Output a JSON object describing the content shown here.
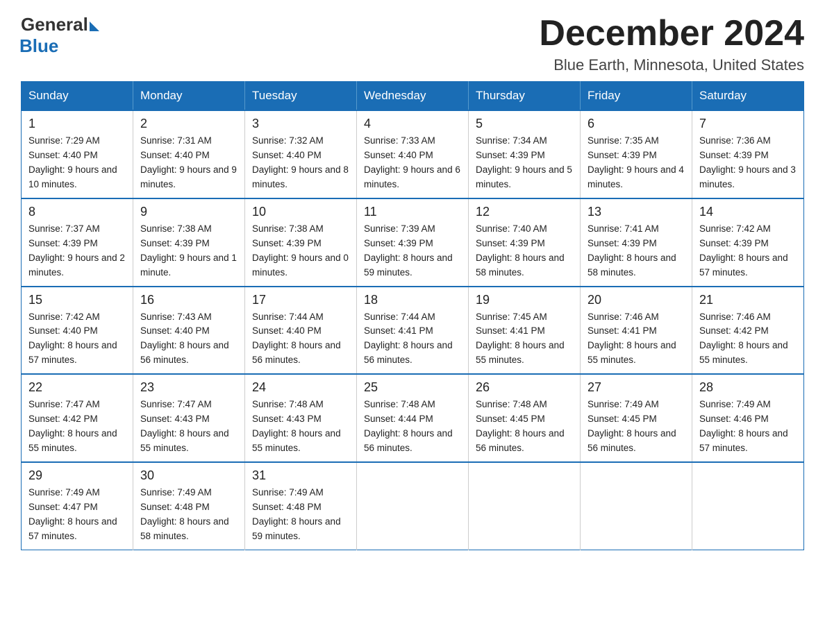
{
  "header": {
    "logo_general": "General",
    "logo_blue": "Blue",
    "month_title": "December 2024",
    "location": "Blue Earth, Minnesota, United States"
  },
  "days_of_week": [
    "Sunday",
    "Monday",
    "Tuesday",
    "Wednesday",
    "Thursday",
    "Friday",
    "Saturday"
  ],
  "weeks": [
    [
      {
        "day": "1",
        "sunrise": "7:29 AM",
        "sunset": "4:40 PM",
        "daylight": "9 hours and 10 minutes."
      },
      {
        "day": "2",
        "sunrise": "7:31 AM",
        "sunset": "4:40 PM",
        "daylight": "9 hours and 9 minutes."
      },
      {
        "day": "3",
        "sunrise": "7:32 AM",
        "sunset": "4:40 PM",
        "daylight": "9 hours and 8 minutes."
      },
      {
        "day": "4",
        "sunrise": "7:33 AM",
        "sunset": "4:40 PM",
        "daylight": "9 hours and 6 minutes."
      },
      {
        "day": "5",
        "sunrise": "7:34 AM",
        "sunset": "4:39 PM",
        "daylight": "9 hours and 5 minutes."
      },
      {
        "day": "6",
        "sunrise": "7:35 AM",
        "sunset": "4:39 PM",
        "daylight": "9 hours and 4 minutes."
      },
      {
        "day": "7",
        "sunrise": "7:36 AM",
        "sunset": "4:39 PM",
        "daylight": "9 hours and 3 minutes."
      }
    ],
    [
      {
        "day": "8",
        "sunrise": "7:37 AM",
        "sunset": "4:39 PM",
        "daylight": "9 hours and 2 minutes."
      },
      {
        "day": "9",
        "sunrise": "7:38 AM",
        "sunset": "4:39 PM",
        "daylight": "9 hours and 1 minute."
      },
      {
        "day": "10",
        "sunrise": "7:38 AM",
        "sunset": "4:39 PM",
        "daylight": "9 hours and 0 minutes."
      },
      {
        "day": "11",
        "sunrise": "7:39 AM",
        "sunset": "4:39 PM",
        "daylight": "8 hours and 59 minutes."
      },
      {
        "day": "12",
        "sunrise": "7:40 AM",
        "sunset": "4:39 PM",
        "daylight": "8 hours and 58 minutes."
      },
      {
        "day": "13",
        "sunrise": "7:41 AM",
        "sunset": "4:39 PM",
        "daylight": "8 hours and 58 minutes."
      },
      {
        "day": "14",
        "sunrise": "7:42 AM",
        "sunset": "4:39 PM",
        "daylight": "8 hours and 57 minutes."
      }
    ],
    [
      {
        "day": "15",
        "sunrise": "7:42 AM",
        "sunset": "4:40 PM",
        "daylight": "8 hours and 57 minutes."
      },
      {
        "day": "16",
        "sunrise": "7:43 AM",
        "sunset": "4:40 PM",
        "daylight": "8 hours and 56 minutes."
      },
      {
        "day": "17",
        "sunrise": "7:44 AM",
        "sunset": "4:40 PM",
        "daylight": "8 hours and 56 minutes."
      },
      {
        "day": "18",
        "sunrise": "7:44 AM",
        "sunset": "4:41 PM",
        "daylight": "8 hours and 56 minutes."
      },
      {
        "day": "19",
        "sunrise": "7:45 AM",
        "sunset": "4:41 PM",
        "daylight": "8 hours and 55 minutes."
      },
      {
        "day": "20",
        "sunrise": "7:46 AM",
        "sunset": "4:41 PM",
        "daylight": "8 hours and 55 minutes."
      },
      {
        "day": "21",
        "sunrise": "7:46 AM",
        "sunset": "4:42 PM",
        "daylight": "8 hours and 55 minutes."
      }
    ],
    [
      {
        "day": "22",
        "sunrise": "7:47 AM",
        "sunset": "4:42 PM",
        "daylight": "8 hours and 55 minutes."
      },
      {
        "day": "23",
        "sunrise": "7:47 AM",
        "sunset": "4:43 PM",
        "daylight": "8 hours and 55 minutes."
      },
      {
        "day": "24",
        "sunrise": "7:48 AM",
        "sunset": "4:43 PM",
        "daylight": "8 hours and 55 minutes."
      },
      {
        "day": "25",
        "sunrise": "7:48 AM",
        "sunset": "4:44 PM",
        "daylight": "8 hours and 56 minutes."
      },
      {
        "day": "26",
        "sunrise": "7:48 AM",
        "sunset": "4:45 PM",
        "daylight": "8 hours and 56 minutes."
      },
      {
        "day": "27",
        "sunrise": "7:49 AM",
        "sunset": "4:45 PM",
        "daylight": "8 hours and 56 minutes."
      },
      {
        "day": "28",
        "sunrise": "7:49 AM",
        "sunset": "4:46 PM",
        "daylight": "8 hours and 57 minutes."
      }
    ],
    [
      {
        "day": "29",
        "sunrise": "7:49 AM",
        "sunset": "4:47 PM",
        "daylight": "8 hours and 57 minutes."
      },
      {
        "day": "30",
        "sunrise": "7:49 AM",
        "sunset": "4:48 PM",
        "daylight": "8 hours and 58 minutes."
      },
      {
        "day": "31",
        "sunrise": "7:49 AM",
        "sunset": "4:48 PM",
        "daylight": "8 hours and 59 minutes."
      },
      null,
      null,
      null,
      null
    ]
  ]
}
